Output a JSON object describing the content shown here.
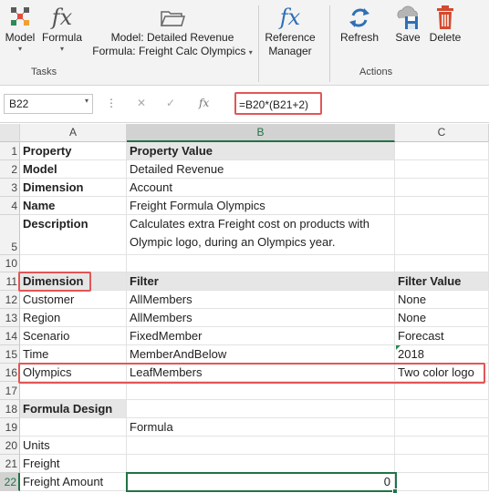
{
  "ribbon": {
    "model_label": "Model",
    "formula_label": "Formula",
    "tasks_group": "Tasks",
    "selection_line1": "Model: Detailed Revenue",
    "selection_line2": "Formula: Freight Calc Olympics",
    "reference_manager_line1": "Reference",
    "reference_manager_line2": "Manager",
    "refresh_label": "Refresh",
    "save_label": "Save",
    "delete_label": "Delete",
    "actions_group": "Actions",
    "caret": "▾"
  },
  "formula_bar": {
    "name_box": "B22",
    "formula": "=B20*(B21+2)",
    "cancel_glyph": "✕",
    "enter_glyph": "✓",
    "fx_glyph": "fx",
    "dots": "⋮"
  },
  "columns": [
    "A",
    "B",
    "C"
  ],
  "rows": {
    "r1": {
      "num": "1",
      "a": "Property",
      "b": "Property Value",
      "c": ""
    },
    "r2": {
      "num": "2",
      "a": "Model",
      "b": "Detailed Revenue",
      "c": ""
    },
    "r3": {
      "num": "3",
      "a": "Dimension",
      "b": "Account",
      "c": ""
    },
    "r4": {
      "num": "4",
      "a": "Name",
      "b": "Freight Formula Olympics",
      "c": ""
    },
    "r5": {
      "num": "5",
      "a": "Description",
      "b": "Calculates extra Freight cost on products with Olympic logo, during an Olympics year.",
      "c": ""
    },
    "r10": {
      "num": "10",
      "a": "",
      "b": "",
      "c": ""
    },
    "r11": {
      "num": "11",
      "a": "Dimension",
      "b": "Filter",
      "c": "Filter Value"
    },
    "r12": {
      "num": "12",
      "a": "Customer",
      "b": "AllMembers",
      "c": "None"
    },
    "r13": {
      "num": "13",
      "a": "Region",
      "b": "AllMembers",
      "c": "None"
    },
    "r14": {
      "num": "14",
      "a": "Scenario",
      "b": "FixedMember",
      "c": "Forecast"
    },
    "r15": {
      "num": "15",
      "a": "Time",
      "b": "MemberAndBelow",
      "c": "2018"
    },
    "r16": {
      "num": "16",
      "a": "Olympics",
      "b": "LeafMembers",
      "c": "Two color logo"
    },
    "r17": {
      "num": "17",
      "a": "",
      "b": "",
      "c": ""
    },
    "r18": {
      "num": "18",
      "a": "Formula Design",
      "b": "",
      "c": ""
    },
    "r19": {
      "num": "19",
      "a": "",
      "b": "Formula",
      "c": ""
    },
    "r20": {
      "num": "20",
      "a": "Units",
      "b": "",
      "c": ""
    },
    "r21": {
      "num": "21",
      "a": "Freight",
      "b": "",
      "c": ""
    },
    "r22": {
      "num": "22",
      "a": "Freight Amount",
      "b": "0",
      "c": ""
    }
  },
  "colors": {
    "highlight": "#e15656",
    "excel_green": "#217346",
    "header_shade": "#e7e6e6"
  },
  "icons": {
    "model": "model-grid-icon",
    "formula": "fx-icon",
    "selection": "folder-icon",
    "reference_manager": "fx-icon",
    "refresh": "refresh-icon",
    "save": "cloud-save-icon",
    "delete": "trash-icon"
  }
}
